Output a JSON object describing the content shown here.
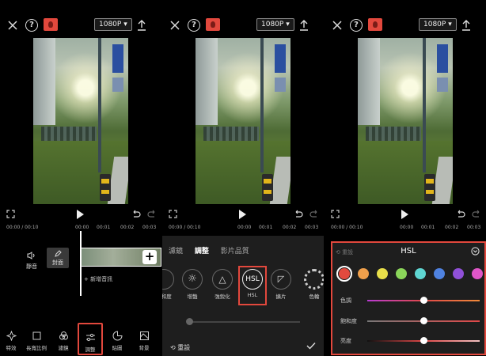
{
  "top": {
    "resolution": "1080P"
  },
  "timeline": {
    "ruler_p1": [
      "00:00 / 00:10",
      "00:00",
      "00:01",
      "00:02",
      "00:03"
    ],
    "ruler_p2": [
      "00:00 / 00:10",
      "00:00",
      "00:01",
      "00:02",
      "00:03"
    ],
    "ruler_p3": [
      "00:00 / 00:10",
      "00:00",
      "00:01",
      "00:02",
      "00:03"
    ],
    "mute_label": "靜音",
    "cover_label": "封面",
    "add_audio": "+ 新增音訊"
  },
  "toolbar": {
    "items": [
      "特效",
      "長寬比例",
      "濾鏡",
      "調整",
      "貼圖",
      "背景"
    ],
    "selected": "調整"
  },
  "adjust_panel": {
    "tabs": [
      "濾鏡",
      "調整",
      "影片品質"
    ],
    "active_tab": "調整",
    "tools": [
      "飽和度",
      "增豔",
      "強銳化",
      "HSL",
      "擴片",
      "色輪"
    ],
    "hsl_icon_text": "HSL",
    "reset": "重設"
  },
  "hsl_panel": {
    "reset": "重設",
    "title": "HSL",
    "swatches": [
      "#e24a3e",
      "#f0a04b",
      "#e9e04a",
      "#8bd65a",
      "#5fd6d2",
      "#4f82e0",
      "#9050d8",
      "#e056c8"
    ],
    "selected_swatch": 0,
    "rows": [
      {
        "label": "色調",
        "value": 0.5
      },
      {
        "label": "飽和度",
        "value": 0.5
      },
      {
        "label": "亮度",
        "value": 0.5
      }
    ]
  },
  "colors": {
    "accent": "#e2483d"
  }
}
